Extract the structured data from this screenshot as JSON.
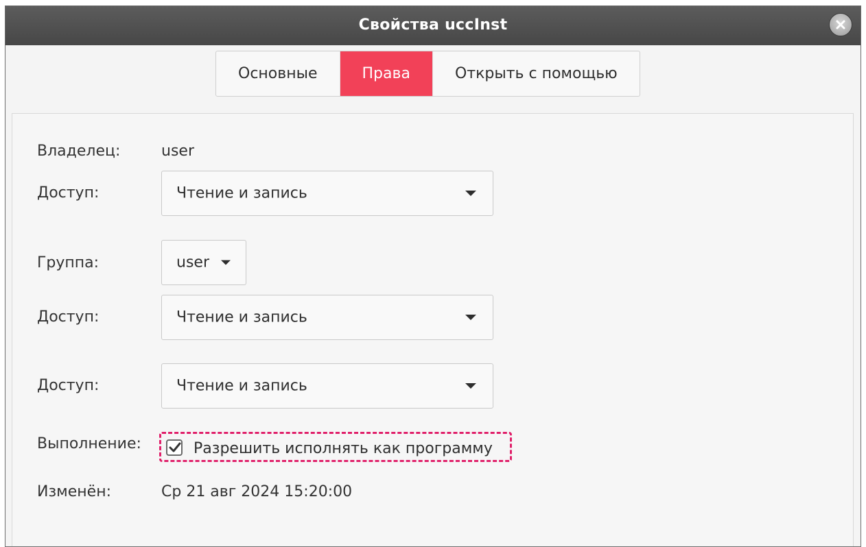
{
  "window": {
    "title": "Свойства uccInst"
  },
  "tabs": [
    {
      "label": "Основные",
      "active": false
    },
    {
      "label": "Права",
      "active": true
    },
    {
      "label": "Открыть с помощью",
      "active": false
    }
  ],
  "permissions": {
    "owner_label": "Владелец:",
    "owner_value": "user",
    "owner_access_label": "Доступ:",
    "owner_access_value": "Чтение и запись",
    "group_label": "Группа:",
    "group_value": "user",
    "group_access_label": "Доступ:",
    "group_access_value": "Чтение и запись",
    "others_access_label": "Доступ:",
    "others_access_value": "Чтение и запись",
    "execute_label": "Выполнение:",
    "execute_checkbox_label": "Разрешить исполнять как программу",
    "execute_checked": true,
    "modified_label": "Изменён:",
    "modified_value": "Ср 21 авг 2024 15:20:00"
  },
  "colors": {
    "accent": "#f24158",
    "highlight": "#e0206a"
  },
  "icons": {
    "close": "close-icon",
    "dropdown": "chevron-down-icon",
    "check": "checkmark-icon"
  }
}
